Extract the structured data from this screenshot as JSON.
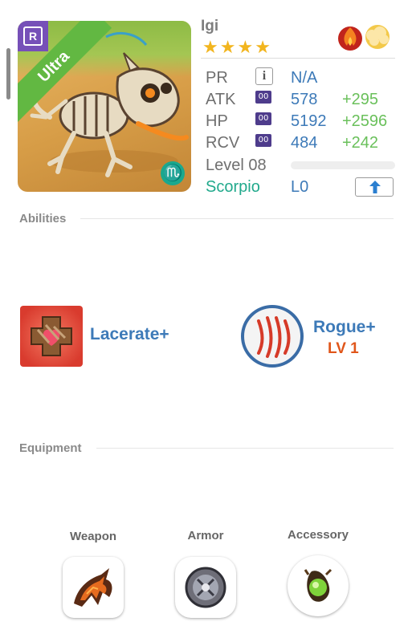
{
  "monster": {
    "name": "Igi",
    "stars": 4,
    "rarity_ribbon": "Ultra",
    "rarity_badge": "R",
    "zodiac_symbol": "♏",
    "elements": [
      "fire-icon",
      "cloud-icon"
    ]
  },
  "stats": {
    "pr": {
      "label": "PR",
      "value": "N/A"
    },
    "atk": {
      "label": "ATK",
      "plus": "00",
      "value": "578",
      "bonus": "+295"
    },
    "hp": {
      "label": "HP",
      "plus": "00",
      "value": "5192",
      "bonus": "+2596"
    },
    "rcv": {
      "label": "RCV",
      "plus": "00",
      "value": "484",
      "bonus": "+242"
    },
    "level": {
      "label": "Level 08",
      "progress": 0.0
    },
    "zodiac": {
      "label": "Scorpio",
      "value": "L0"
    }
  },
  "abilities": {
    "title": "Abilities",
    "items": [
      {
        "name": "Lacerate+",
        "icon": "lacerate-icon"
      },
      {
        "name": "Rogue+",
        "level": "LV 1",
        "icon": "rogue-claw-icon"
      }
    ]
  },
  "equipment": {
    "title": "Equipment",
    "slots": [
      {
        "label": "Weapon",
        "icon": "weapon-claw-icon"
      },
      {
        "label": "Armor",
        "icon": "armor-shield-icon"
      },
      {
        "label": "Accessory",
        "icon": "accessory-orb-icon"
      }
    ]
  },
  "colors": {
    "accent_blue": "#3d7ab8",
    "bonus_green": "#6ac05b",
    "zodiac_teal": "#21a98c",
    "plus_purple": "#4e3c8c",
    "rogue_level_orange": "#e0561a"
  }
}
